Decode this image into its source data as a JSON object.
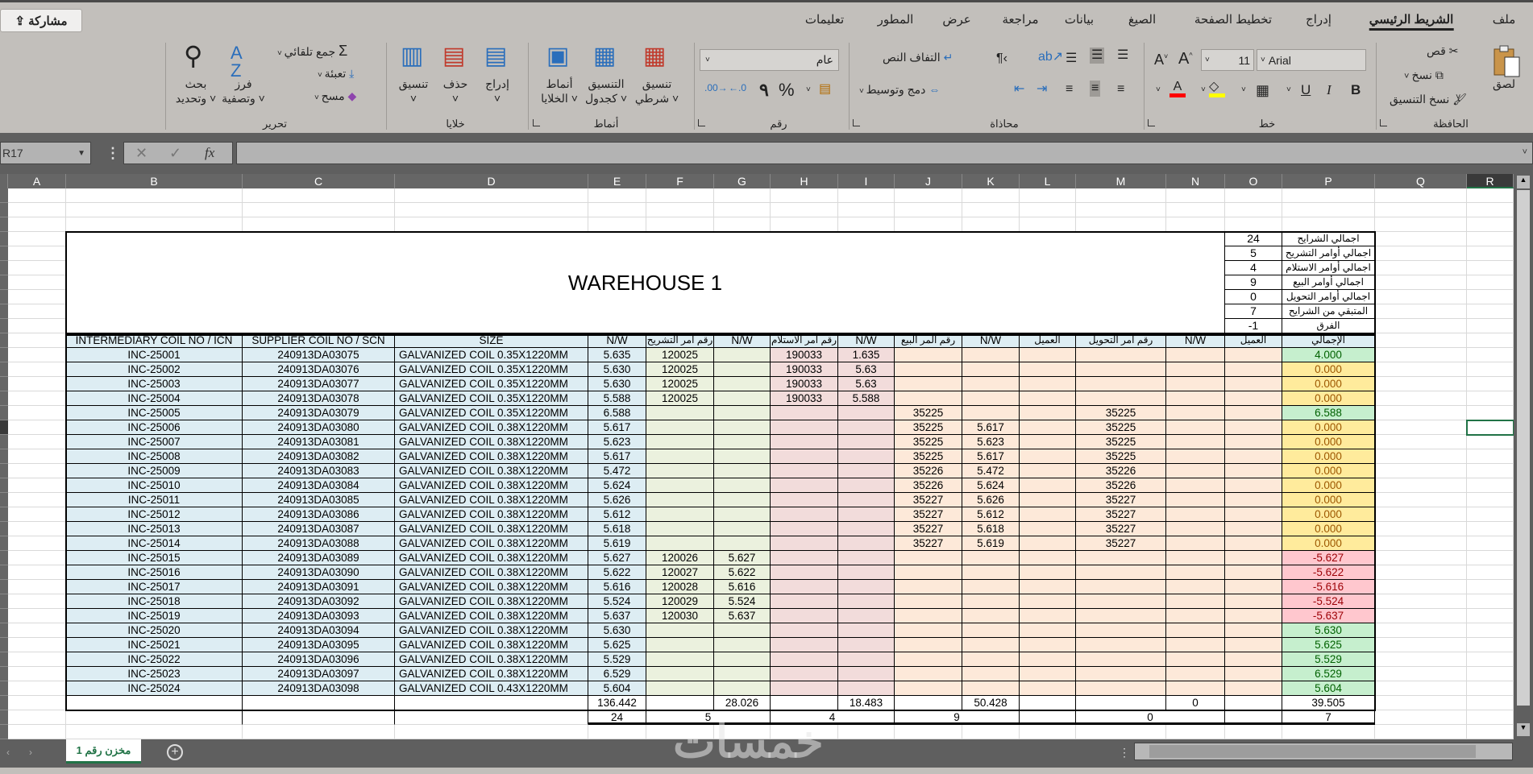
{
  "ribbon": {
    "share_label": "مشاركة",
    "tabs": [
      "ملف",
      "الشريط الرئيسي",
      "إدراج",
      "تخطيط الصفحة",
      "الصيغ",
      "بيانات",
      "مراجعة",
      "عرض",
      "المطور",
      "تعليمات"
    ],
    "clipboard": {
      "paste": "لصق",
      "cut": "قص",
      "copy": "نسخ",
      "format_painter": "نسخ التنسيق",
      "group": "الحافظة"
    },
    "font": {
      "name": "Arial",
      "size": "11",
      "bold": "B",
      "italic": "I",
      "underline": "U",
      "group": "خط"
    },
    "alignment": {
      "wrap": "التفاف النص",
      "merge": "دمج وتوسيط",
      "group": "محاذاة"
    },
    "number": {
      "format": "عام",
      "percent": "%",
      "comma": "٩",
      "group": "رقم"
    },
    "styles": {
      "conditional": "تنسيق\nشرطي ˅",
      "table": "التنسيق\nكجدول ˅",
      "cell": "أنماط\nالخلايا ˅",
      "group": "أنماط"
    },
    "cells": {
      "insert": "إدراج\n˅",
      "delete": "حذف\n˅",
      "format": "تنسيق\n˅",
      "group": "خلايا"
    },
    "editing": {
      "autosum": "جمع تلقائي",
      "fill": "تعبئة",
      "clear": "مسح",
      "sort": "فرز\nوتصفية ˅",
      "find": "بحث\nوتحديد ˅",
      "group": "تحرير"
    }
  },
  "formula_bar": {
    "name_box": "R17",
    "fx": "fx",
    "value": ""
  },
  "columns": [
    "A",
    "B",
    "C",
    "D",
    "E",
    "F",
    "G",
    "H",
    "I",
    "J",
    "K",
    "L",
    "M",
    "N",
    "O",
    "P",
    "Q",
    "R"
  ],
  "sheet": {
    "title": "WAREHOUSE 1",
    "summary": [
      {
        "label": "اجمالي الشرايح",
        "value": "24"
      },
      {
        "label": "اجمالي أوامر التشريح",
        "value": "5"
      },
      {
        "label": "اجمالي أوامر الاستلام",
        "value": "4"
      },
      {
        "label": "اجمالي أوامر البيع",
        "value": "9"
      },
      {
        "label": "اجمالي أوامر التحويل",
        "value": "0"
      },
      {
        "label": "المتبقي من الشرايح",
        "value": "7"
      },
      {
        "label": "الفرق",
        "value": "-1"
      }
    ],
    "headers": [
      "INTERMEDIARY COIL NO / ICN",
      "SUPPLIER COIL NO / SCN",
      "SIZE",
      "N/W",
      "رقم امر التشريح",
      "N/W",
      "رقم امر الاستلام",
      "N/W",
      "رقم المر البيع",
      "N/W",
      "العميل",
      "رقم امر التحويل",
      "N/W",
      "العميل",
      "الإجمالي"
    ],
    "rows": [
      {
        "b": "INC-25001",
        "c": "240913DA03075",
        "d": "GALVANIZED  COIL 0.35X1220MM",
        "e": "5.635",
        "f": "120025",
        "h": "190033",
        "i": "1.635",
        "p": "4.000",
        "s": "green"
      },
      {
        "b": "INC-25002",
        "c": "240913DA03076",
        "d": "GALVANIZED  COIL 0.35X1220MM",
        "e": "5.630",
        "f": "120025",
        "h": "190033",
        "i": "5.63",
        "p": "0.000",
        "s": "yellow"
      },
      {
        "b": "INC-25003",
        "c": "240913DA03077",
        "d": "GALVANIZED  COIL 0.35X1220MM",
        "e": "5.630",
        "f": "120025",
        "h": "190033",
        "i": "5.63",
        "p": "0.000",
        "s": "yellow"
      },
      {
        "b": "INC-25004",
        "c": "240913DA03078",
        "d": "GALVANIZED  COIL 0.35X1220MM",
        "e": "5.588",
        "f": "120025",
        "h": "190033",
        "i": "5.588",
        "p": "0.000",
        "s": "yellow"
      },
      {
        "b": "INC-25005",
        "c": "240913DA03079",
        "d": "GALVANIZED  COIL 0.35X1220MM",
        "e": "6.588",
        "j": "35225",
        "m": "35225",
        "p": "6.588",
        "s": "green"
      },
      {
        "b": "INC-25006",
        "c": "240913DA03080",
        "d": "GALVANIZED  COIL 0.38X1220MM",
        "e": "5.617",
        "j": "35225",
        "k": "5.617",
        "m": "35225",
        "p": "0.000",
        "s": "yellow"
      },
      {
        "b": "INC-25007",
        "c": "240913DA03081",
        "d": "GALVANIZED  COIL 0.38X1220MM",
        "e": "5.623",
        "j": "35225",
        "k": "5.623",
        "m": "35225",
        "p": "0.000",
        "s": "yellow"
      },
      {
        "b": "INC-25008",
        "c": "240913DA03082",
        "d": "GALVANIZED  COIL 0.38X1220MM",
        "e": "5.617",
        "j": "35225",
        "k": "5.617",
        "m": "35225",
        "p": "0.000",
        "s": "yellow"
      },
      {
        "b": "INC-25009",
        "c": "240913DA03083",
        "d": "GALVANIZED  COIL 0.38X1220MM",
        "e": "5.472",
        "j": "35226",
        "k": "5.472",
        "m": "35226",
        "p": "0.000",
        "s": "yellow"
      },
      {
        "b": "INC-25010",
        "c": "240913DA03084",
        "d": "GALVANIZED  COIL 0.38X1220MM",
        "e": "5.624",
        "j": "35226",
        "k": "5.624",
        "m": "35226",
        "p": "0.000",
        "s": "yellow"
      },
      {
        "b": "INC-25011",
        "c": "240913DA03085",
        "d": "GALVANIZED  COIL 0.38X1220MM",
        "e": "5.626",
        "j": "35227",
        "k": "5.626",
        "m": "35227",
        "p": "0.000",
        "s": "yellow"
      },
      {
        "b": "INC-25012",
        "c": "240913DA03086",
        "d": "GALVANIZED  COIL 0.38X1220MM",
        "e": "5.612",
        "j": "35227",
        "k": "5.612",
        "m": "35227",
        "p": "0.000",
        "s": "yellow"
      },
      {
        "b": "INC-25013",
        "c": "240913DA03087",
        "d": "GALVANIZED  COIL 0.38X1220MM",
        "e": "5.618",
        "j": "35227",
        "k": "5.618",
        "m": "35227",
        "p": "0.000",
        "s": "yellow"
      },
      {
        "b": "INC-25014",
        "c": "240913DA03088",
        "d": "GALVANIZED  COIL 0.38X1220MM",
        "e": "5.619",
        "j": "35227",
        "k": "5.619",
        "m": "35227",
        "p": "0.000",
        "s": "yellow"
      },
      {
        "b": "INC-25015",
        "c": "240913DA03089",
        "d": "GALVANIZED  COIL 0.38X1220MM",
        "e": "5.627",
        "f": "120026",
        "g": "5.627",
        "p": "-5.627",
        "s": "red"
      },
      {
        "b": "INC-25016",
        "c": "240913DA03090",
        "d": "GALVANIZED  COIL 0.38X1220MM",
        "e": "5.622",
        "f": "120027",
        "g": "5.622",
        "p": "-5.622",
        "s": "red"
      },
      {
        "b": "INC-25017",
        "c": "240913DA03091",
        "d": "GALVANIZED  COIL 0.38X1220MM",
        "e": "5.616",
        "f": "120028",
        "g": "5.616",
        "p": "-5.616",
        "s": "red"
      },
      {
        "b": "INC-25018",
        "c": "240913DA03092",
        "d": "GALVANIZED  COIL 0.38X1220MM",
        "e": "5.524",
        "f": "120029",
        "g": "5.524",
        "p": "-5.524",
        "s": "red"
      },
      {
        "b": "INC-25019",
        "c": "240913DA03093",
        "d": "GALVANIZED  COIL 0.38X1220MM",
        "e": "5.637",
        "f": "120030",
        "g": "5.637",
        "p": "-5.637",
        "s": "red"
      },
      {
        "b": "INC-25020",
        "c": "240913DA03094",
        "d": "GALVANIZED  COIL 0.38X1220MM",
        "e": "5.630",
        "p": "5.630",
        "s": "green"
      },
      {
        "b": "INC-25021",
        "c": "240913DA03095",
        "d": "GALVANIZED  COIL 0.38X1220MM",
        "e": "5.625",
        "p": "5.625",
        "s": "green"
      },
      {
        "b": "INC-25022",
        "c": "240913DA03096",
        "d": "GALVANIZED  COIL 0.38X1220MM",
        "e": "5.529",
        "p": "5.529",
        "s": "green"
      },
      {
        "b": "INC-25023",
        "c": "240913DA03097",
        "d": "GALVANIZED  COIL 0.38X1220MM",
        "e": "6.529",
        "p": "6.529",
        "s": "green"
      },
      {
        "b": "INC-25024",
        "c": "240913DA03098",
        "d": "GALVANIZED  COIL 0.43X1220MM",
        "e": "5.604",
        "p": "5.604",
        "s": "green"
      }
    ],
    "totals": {
      "e": "136.442",
      "g": "28.026",
      "i": "18.483",
      "k": "50.428",
      "n": "0",
      "p": "39.505"
    },
    "counts": {
      "e": "24",
      "fg": "5",
      "hi": "4",
      "jk": "9",
      "mn": "0",
      "p": "7"
    }
  },
  "sheet_tab": "مخزن رقم 1",
  "watermark": "خمسات",
  "colors": {
    "blue_fill": "#DDEDF3",
    "green_fill": "#EBF1DE",
    "pink_fill": "#F2DCDB",
    "peach_fill": "#FDE9D9",
    "status_green_bg": "#C6EFCE",
    "status_green_fg": "#006100",
    "status_yellow_bg": "#FFEB9C",
    "status_yellow_fg": "#9C5700",
    "status_red_bg": "#FFC7CE",
    "status_red_fg": "#9C0006",
    "selection": "#217346"
  }
}
